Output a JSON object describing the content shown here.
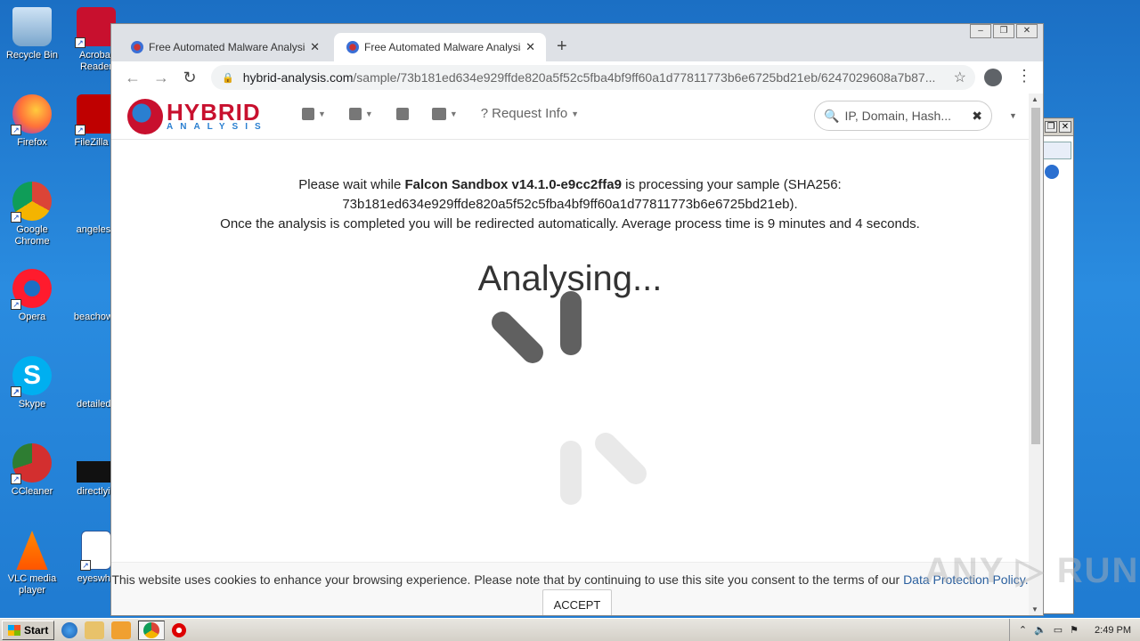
{
  "desktop": {
    "icons": [
      {
        "label": "Recycle Bin"
      },
      {
        "label": "Acrobat Reader"
      },
      {
        "label": "Firefox"
      },
      {
        "label": "FileZilla C"
      },
      {
        "label": "Google Chrome"
      },
      {
        "label": "angelesh"
      },
      {
        "label": "Opera"
      },
      {
        "label": "beachown"
      },
      {
        "label": "Skype"
      },
      {
        "label": "detailedc"
      },
      {
        "label": "CCleaner"
      },
      {
        "label": "directlyid"
      },
      {
        "label": "VLC media player"
      },
      {
        "label": "eyeswhc"
      }
    ]
  },
  "browser": {
    "tabs": [
      {
        "title": "Free Automated Malware Analysis S",
        "close": "✕"
      },
      {
        "title": "Free Automated Malware Analysis S",
        "close": "✕"
      }
    ],
    "new_tab": "+",
    "url_host": "hybrid-analysis.com",
    "url_path": "/sample/73b181ed634e929ffde820a5f52c5fba4bf9ff60a1d77811773b6e6725bd21eb/6247029608a7b87...",
    "window_controls": [
      "–",
      "❐",
      "✕"
    ]
  },
  "site": {
    "logo_top": "HYBRID",
    "logo_bottom": "ANALYSIS",
    "menu": {
      "request_info": "Request Info"
    },
    "search_placeholder": "IP, Domain, Hash...",
    "clear": "✖"
  },
  "status": {
    "line1_prefix": "Please wait while ",
    "sandbox": "Falcon Sandbox v14.1.0-e9cc2ffa9",
    "line1_suffix": " is processing your sample (SHA256:",
    "hash": "73b181ed634e929ffde820a5f52c5fba4bf9ff60a1d77811773b6e6725bd21eb).",
    "line3": "Once the analysis is completed you will be redirected automatically. Average process time is 9 minutes and 4 seconds.",
    "headline": "Analysing..."
  },
  "cookie": {
    "text": "This website uses cookies to enhance your browsing experience. Please note that by continuing to use this site you consent to the terms of our ",
    "link": "Data Protection Policy.",
    "accept": "ACCEPT"
  },
  "watermark": "ANY ▷ RUN",
  "taskbar": {
    "start": "Start",
    "clock": "2:49 PM"
  },
  "colors": {
    "brand_red": "#c8102e",
    "brand_blue": "#2a7fd0",
    "desktop_blue": "#1f7ad0"
  }
}
